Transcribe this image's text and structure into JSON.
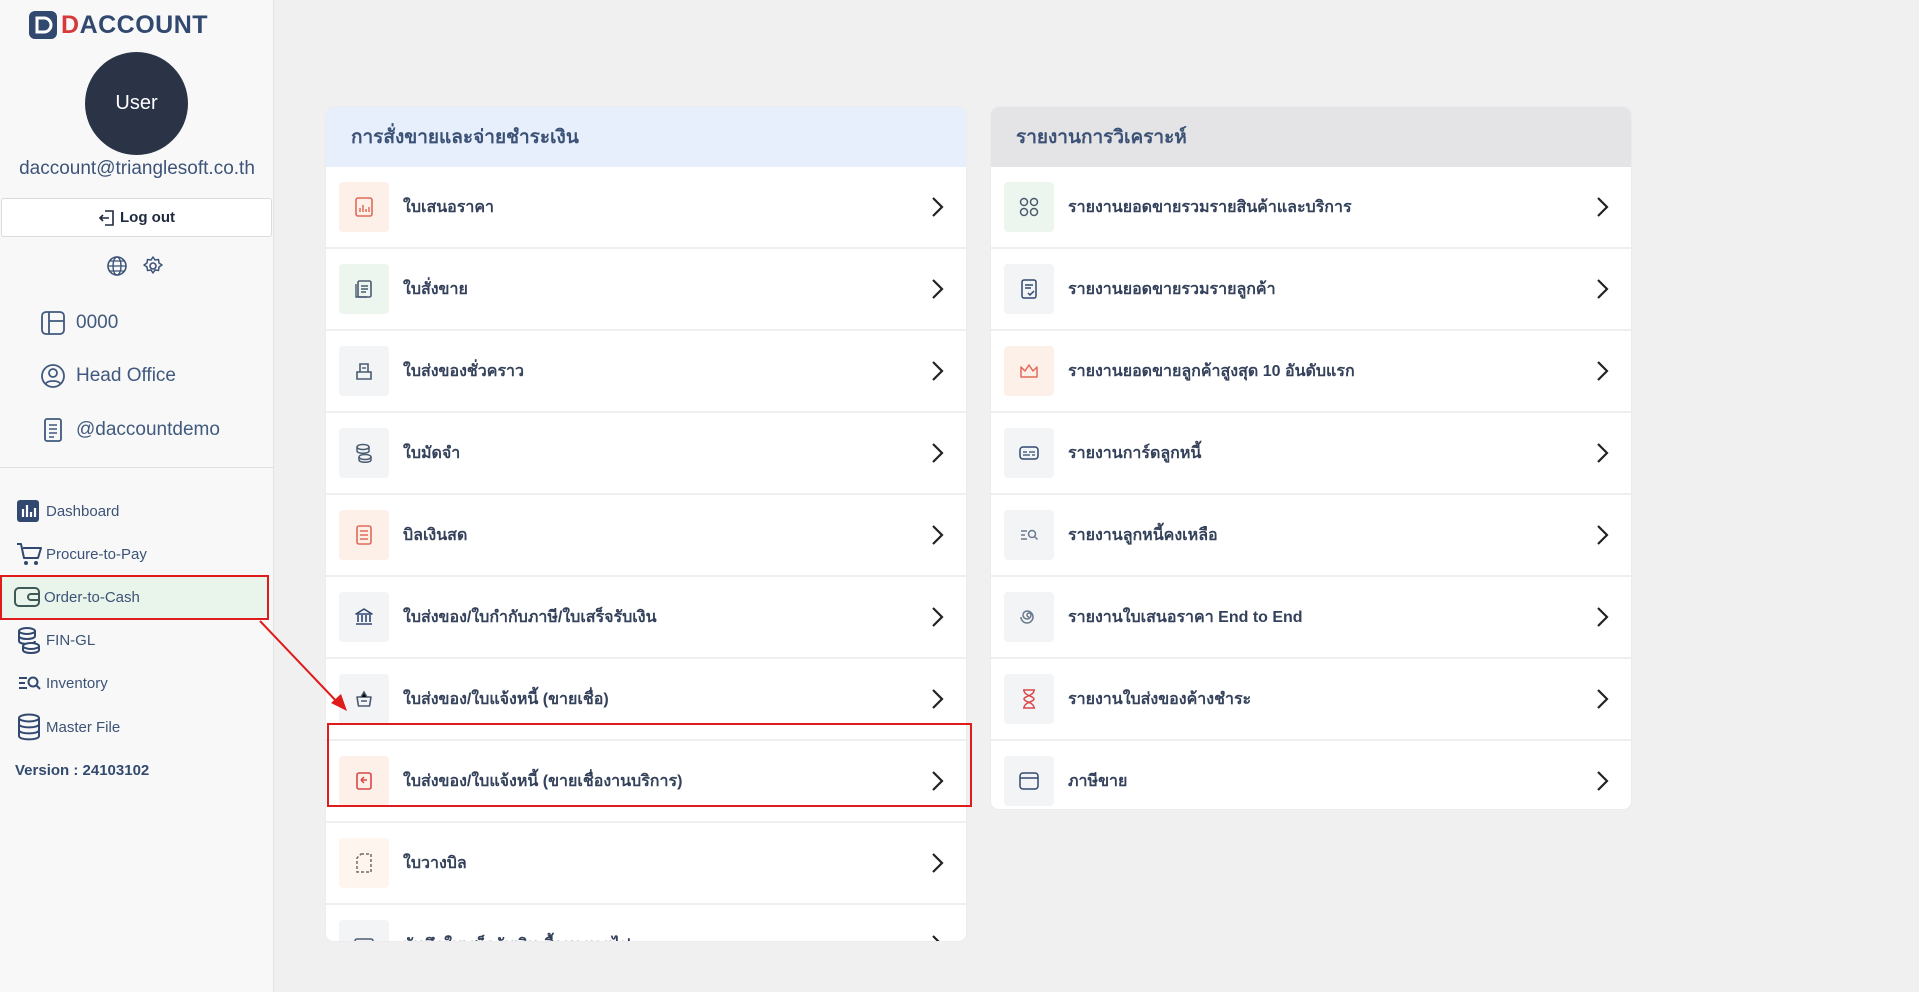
{
  "brand": {
    "name_accent": "D",
    "name_rest": "ACCOUNT"
  },
  "user": {
    "avatar_label": "User",
    "email": "daccount@trianglesoft.co.th",
    "logout_label": "Log out"
  },
  "sidebar_icons": [
    "globe-icon",
    "gear-icon"
  ],
  "info": [
    {
      "text": "0000",
      "icon": "layout-icon"
    },
    {
      "text": "Head Office",
      "icon": "user-circle-icon"
    },
    {
      "text": "@daccountdemo",
      "icon": "document-icon"
    }
  ],
  "nav": [
    {
      "label": "Dashboard",
      "icon": "bar-chart-icon"
    },
    {
      "label": "Procure-to-Pay",
      "icon": "cart-icon"
    },
    {
      "label": "Order-to-Cash",
      "icon": "wallet-icon",
      "active": true
    },
    {
      "label": "FIN-GL",
      "icon": "coins-icon"
    },
    {
      "label": "Inventory",
      "icon": "list-search-icon"
    },
    {
      "label": "Master File",
      "icon": "database-icon"
    }
  ],
  "version": "Version : 24103102",
  "left_panel": {
    "title": "การสั่งขายและจ่ายชำระเงิน",
    "rows": [
      "ใบเสนอราคา",
      "ใบสั่งขาย",
      "ใบส่งของชั่วคราว",
      "ใบมัดจำ",
      "บิลเงินสด",
      "ใบส่งของ/ใบกำกับภาษี/ใบเสร็จรับเงิน",
      "ใบส่งของ/ใบแจ้งหนี้ (ขายเชื่อ)",
      "ใบส่งของ/ใบแจ้งหนี้ (ขายเชื่องานบริการ)",
      "ใบวางบิล",
      "บันทึกใบเสร็จรับเงิน ซื้อมาขายไป"
    ]
  },
  "right_panel": {
    "title": "รายงานการวิเคราะห์",
    "rows": [
      "รายงานยอดขายรวมรายสินค้าและบริการ",
      "รายงานยอดขายรวมรายลูกค้า",
      "รายงานยอดขายลูกค้าสูงสุด 10 อันดับแรก",
      "รายงานการ์ดลูกหนี้",
      "รายงานลูกหนี้คงเหลือ",
      "รายงานใบเสนอราคา End to End",
      "รายงานใบส่งของค้างชำระ",
      "ภาษีขาย"
    ]
  },
  "colors": {
    "accent_red": "#e01b1b",
    "sidebar_active": "#e9f4ea",
    "left_header": "#e8effc",
    "right_header": "#e4e4e6"
  }
}
